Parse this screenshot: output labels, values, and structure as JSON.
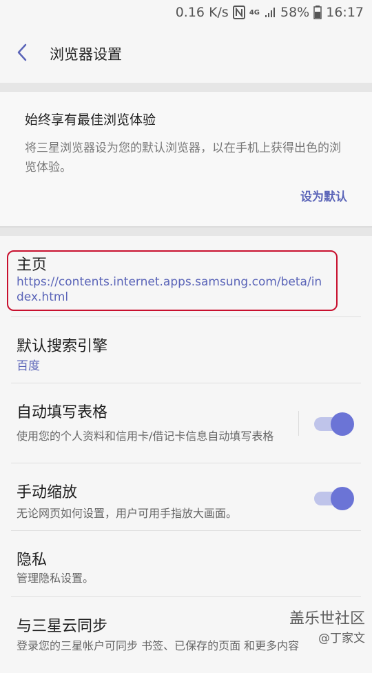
{
  "status_bar": {
    "network_speed": "0.16 K/s",
    "signal_label": "4G",
    "battery": "58%",
    "time": "16:17"
  },
  "header": {
    "title": "浏览器设置"
  },
  "promo_card": {
    "title": "始终享有最佳浏览体验",
    "description": "将三星浏览器设为您的默认浏览器，以在手机上获得出色的浏览体验。",
    "action_label": "设为默认"
  },
  "settings": {
    "homepage": {
      "title": "主页",
      "value": "https://contents.internet.apps.samsung.com/beta/index.html"
    },
    "search_engine": {
      "title": "默认搜索引擎",
      "value": "百度"
    },
    "autofill": {
      "title": "自动填写表格",
      "description": "使用您的个人资料和信用卡/借记卡信息自动填写表格",
      "enabled": true
    },
    "manual_zoom": {
      "title": "手动缩放",
      "description": "无论网页如何设置，用户可用手指放大画面。",
      "enabled": true
    },
    "privacy": {
      "title": "隐私",
      "description": "管理隐私设置。"
    },
    "samsung_cloud_sync": {
      "title": "与三星云同步",
      "description": "登录您的三星帐户可同步 书签、已保存的页面 和更多内容"
    }
  },
  "watermark": {
    "line1": "盖乐世社区",
    "line2": "@丁家文"
  },
  "colors": {
    "accent": "#5a64b8",
    "toggle_on": "#6b74d6",
    "highlight": "#c8102e"
  }
}
